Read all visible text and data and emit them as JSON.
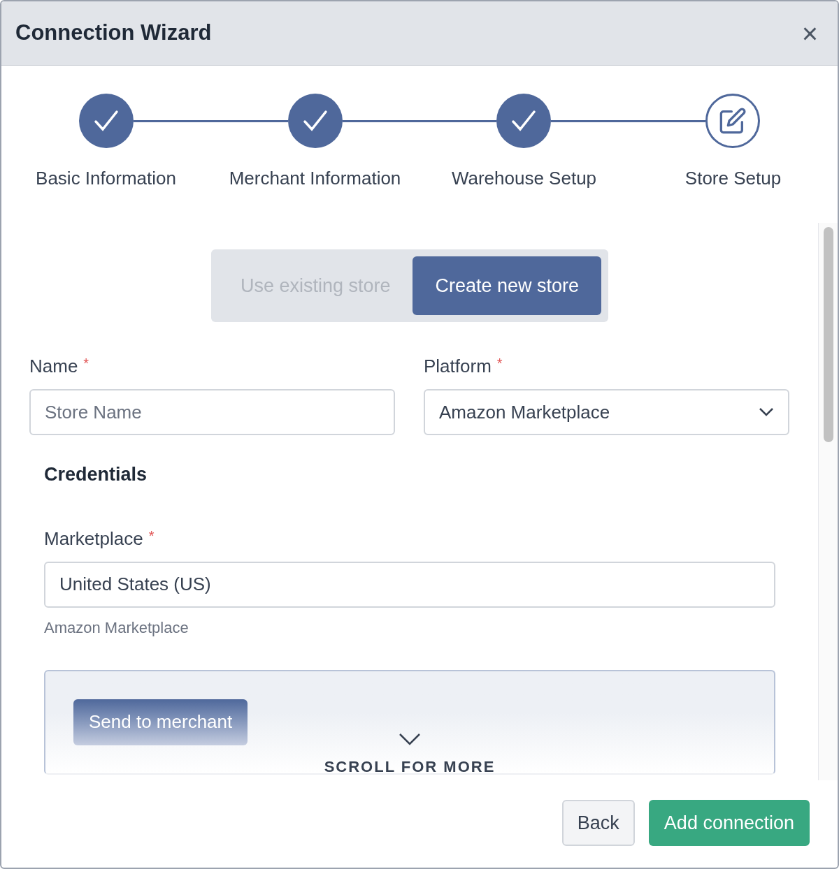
{
  "window": {
    "title": "Connection Wizard",
    "close": "×"
  },
  "steps": [
    {
      "label": "Basic Information",
      "completed": true
    },
    {
      "label": "Merchant Information",
      "completed": true
    },
    {
      "label": "Warehouse Setup",
      "completed": true
    },
    {
      "label": "Store Setup",
      "completed": false
    }
  ],
  "store_mode": [
    {
      "label": "Use existing store",
      "selected": false
    },
    {
      "label": "Create new store",
      "selected": true
    }
  ],
  "name_field": {
    "label": "Name",
    "required_mark": "*",
    "placeholder": "Store Name"
  },
  "platform_field": {
    "label": "Platform",
    "required_mark": "*",
    "value": "Amazon Marketplace"
  },
  "credentials": {
    "heading": "Credentials",
    "marketplace_field": {
      "label": "Marketplace",
      "required_mark": "*",
      "value": "United States (US)",
      "helper": "Amazon Marketplace"
    },
    "send_button": "Send to merchant"
  },
  "scroll_hint": "SCROLL FOR MORE",
  "footer_buttons": [
    {
      "label": "Back",
      "kind": "secondary"
    },
    {
      "label": "Add connection",
      "kind": "primary"
    }
  ]
}
